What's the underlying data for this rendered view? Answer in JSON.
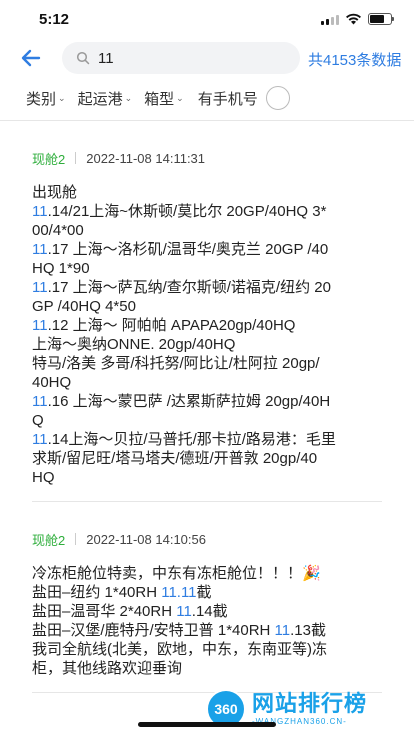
{
  "status_bar": {
    "time": "5:12"
  },
  "header": {
    "search_value": "11",
    "total_count": "共4153条数据"
  },
  "filters": [
    {
      "label": "类别"
    },
    {
      "label": "起运港"
    },
    {
      "label": "箱型"
    }
  ],
  "phone_filter_label": "有手机号",
  "cards": [
    {
      "tag": "现舱2",
      "time": "2022-11-08 14:11:31",
      "lines": [
        [
          {
            "t": "出现舱"
          }
        ],
        [
          {
            "t": "11",
            "hl": true
          },
          {
            "t": ".14/21上海~休斯顿/莫比尔 20GP/40HQ 3*"
          }
        ],
        [
          {
            "t": "00/4*00"
          }
        ],
        [
          {
            "t": "11",
            "hl": true
          },
          {
            "t": ".17 上海～洛杉矶/温哥华/奥克兰 20GP /40"
          }
        ],
        [
          {
            "t": "HQ 1*90"
          }
        ],
        [
          {
            "t": "11",
            "hl": true
          },
          {
            "t": ".17 上海～萨瓦纳/查尔斯顿/诺福克/纽约 20"
          }
        ],
        [
          {
            "t": "GP /40HQ 4*50"
          }
        ],
        [
          {
            "t": "11",
            "hl": true
          },
          {
            "t": ".12 上海～ 阿帕帕 APAPA20gp/40HQ"
          }
        ],
        [
          {
            "t": "上海～奥纳ONNE. 20gp/40HQ"
          }
        ],
        [
          {
            "t": "特马/洛美 多哥/科托努/阿比让/杜阿拉 20gp/"
          }
        ],
        [
          {
            "t": "40HQ"
          }
        ],
        [
          {
            "t": "11",
            "hl": true
          },
          {
            "t": ".16 上海～蒙巴萨 /达累斯萨拉姆 20gp/40H"
          }
        ],
        [
          {
            "t": "Q"
          }
        ],
        [
          {
            "t": "11",
            "hl": true
          },
          {
            "t": ".14上海～贝拉/马普托/那卡拉/路易港：毛里"
          }
        ],
        [
          {
            "t": "求斯/留尼旺/塔马塔夫/德班/开普敦 20gp/40"
          }
        ],
        [
          {
            "t": "HQ"
          }
        ]
      ]
    },
    {
      "tag": "现舱2",
      "time": "2022-11-08 14:10:56",
      "lines": [
        [
          {
            "t": "冷冻柜舱位特卖，中东有冻柜舱位！！！🎉"
          }
        ],
        [
          {
            "t": "盐田–纽约 1*40RH "
          },
          {
            "t": "11.11",
            "hl": true
          },
          {
            "t": "截"
          }
        ],
        [
          {
            "t": "盐田–温哥华 2*40RH "
          },
          {
            "t": "11",
            "hl": true
          },
          {
            "t": ".14截"
          }
        ],
        [
          {
            "t": "盐田–汉堡/鹿特丹/安特卫普 1*40RH "
          },
          {
            "t": "11",
            "hl": true
          },
          {
            "t": ".13截"
          }
        ],
        [
          {
            "t": "我司全航线(北美，欧地，中东，东南亚等)冻"
          }
        ],
        [
          {
            "t": "柜，其他线路欢迎垂询"
          }
        ]
      ]
    }
  ],
  "watermark": {
    "logo": "360",
    "main": "网站排行榜",
    "sub": "-WANGZHAN360.CN-"
  },
  "colors": {
    "accent": "#2f7de1",
    "tag": "#2fae3c"
  }
}
